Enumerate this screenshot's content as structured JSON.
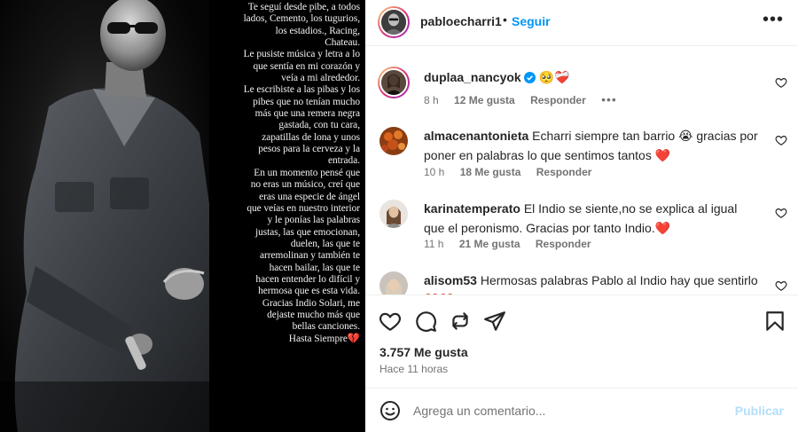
{
  "post": {
    "story_text": [
      "Te seguí desde pibe,  a todos",
      "lados,  Cemento, los tugurios,",
      "los estadios., Racing,",
      "Chateau.",
      "Le pusiste música y letra a lo",
      "que sentía en mi corazón y",
      "veía a mi alrededor.",
      "Le escribiste a las pibas y los",
      "pibes que no tenían mucho",
      "más que una remera negra",
      "gastada, con tu cara,",
      "zapatillas de lona y unos",
      "pesos para la cerveza y la",
      "entrada.",
      "En un momento pensé que",
      "no eras un músico, creí que",
      "eras una especie de ángel",
      "que veías en nuestro interior",
      "y le ponías las palabras",
      "justas,  las que emocionan,",
      "duelen, las que te",
      "arremolinan  y también te",
      "hacen bailar, las que te",
      "hacen entender lo difícil y",
      "hermosa que es esta vida.",
      "Gracias Indio Solari, me",
      "dejaste mucho más que",
      "bellas canciones.",
      "Hasta Siempre💔"
    ]
  },
  "header": {
    "username": "pabloecharri1",
    "separator": "•",
    "follow_label": "Seguir",
    "more_label": "•••"
  },
  "comments": [
    {
      "username": "duplaa_nancyok",
      "text": "🥺❤️‍🩹",
      "time": "8 h",
      "likes": "12 Me gusta",
      "reply": "Responder",
      "more": "•••"
    },
    {
      "username": "almacenantonieta",
      "text": "Echarri siempre tan barrio 😭 gracias por poner en palabras lo que sentimos tantos ❤️",
      "time": "10 h",
      "likes": "18 Me gusta",
      "reply": "Responder"
    },
    {
      "username": "karinatemperato",
      "text": "El Indio se siente,no se explica al igual que el peronismo. Gracias por tanto Indio.❤️",
      "time": "11 h",
      "likes": "21 Me gusta",
      "reply": "Responder"
    },
    {
      "username": "alisom53",
      "text": "Hermosas palabras Pablo al Indio hay que sentirlo ❤️❤️"
    }
  ],
  "actions": {
    "likes_count": "3.757 Me gusta",
    "timestamp": "Hace 11 horas"
  },
  "composer": {
    "placeholder": "Agrega un comentario...",
    "publish_label": "Publicar"
  },
  "colors": {
    "accent": "#0095f6",
    "publish_disabled": "#b2dffc",
    "heart": "#e0245e",
    "muted": "#737373"
  }
}
